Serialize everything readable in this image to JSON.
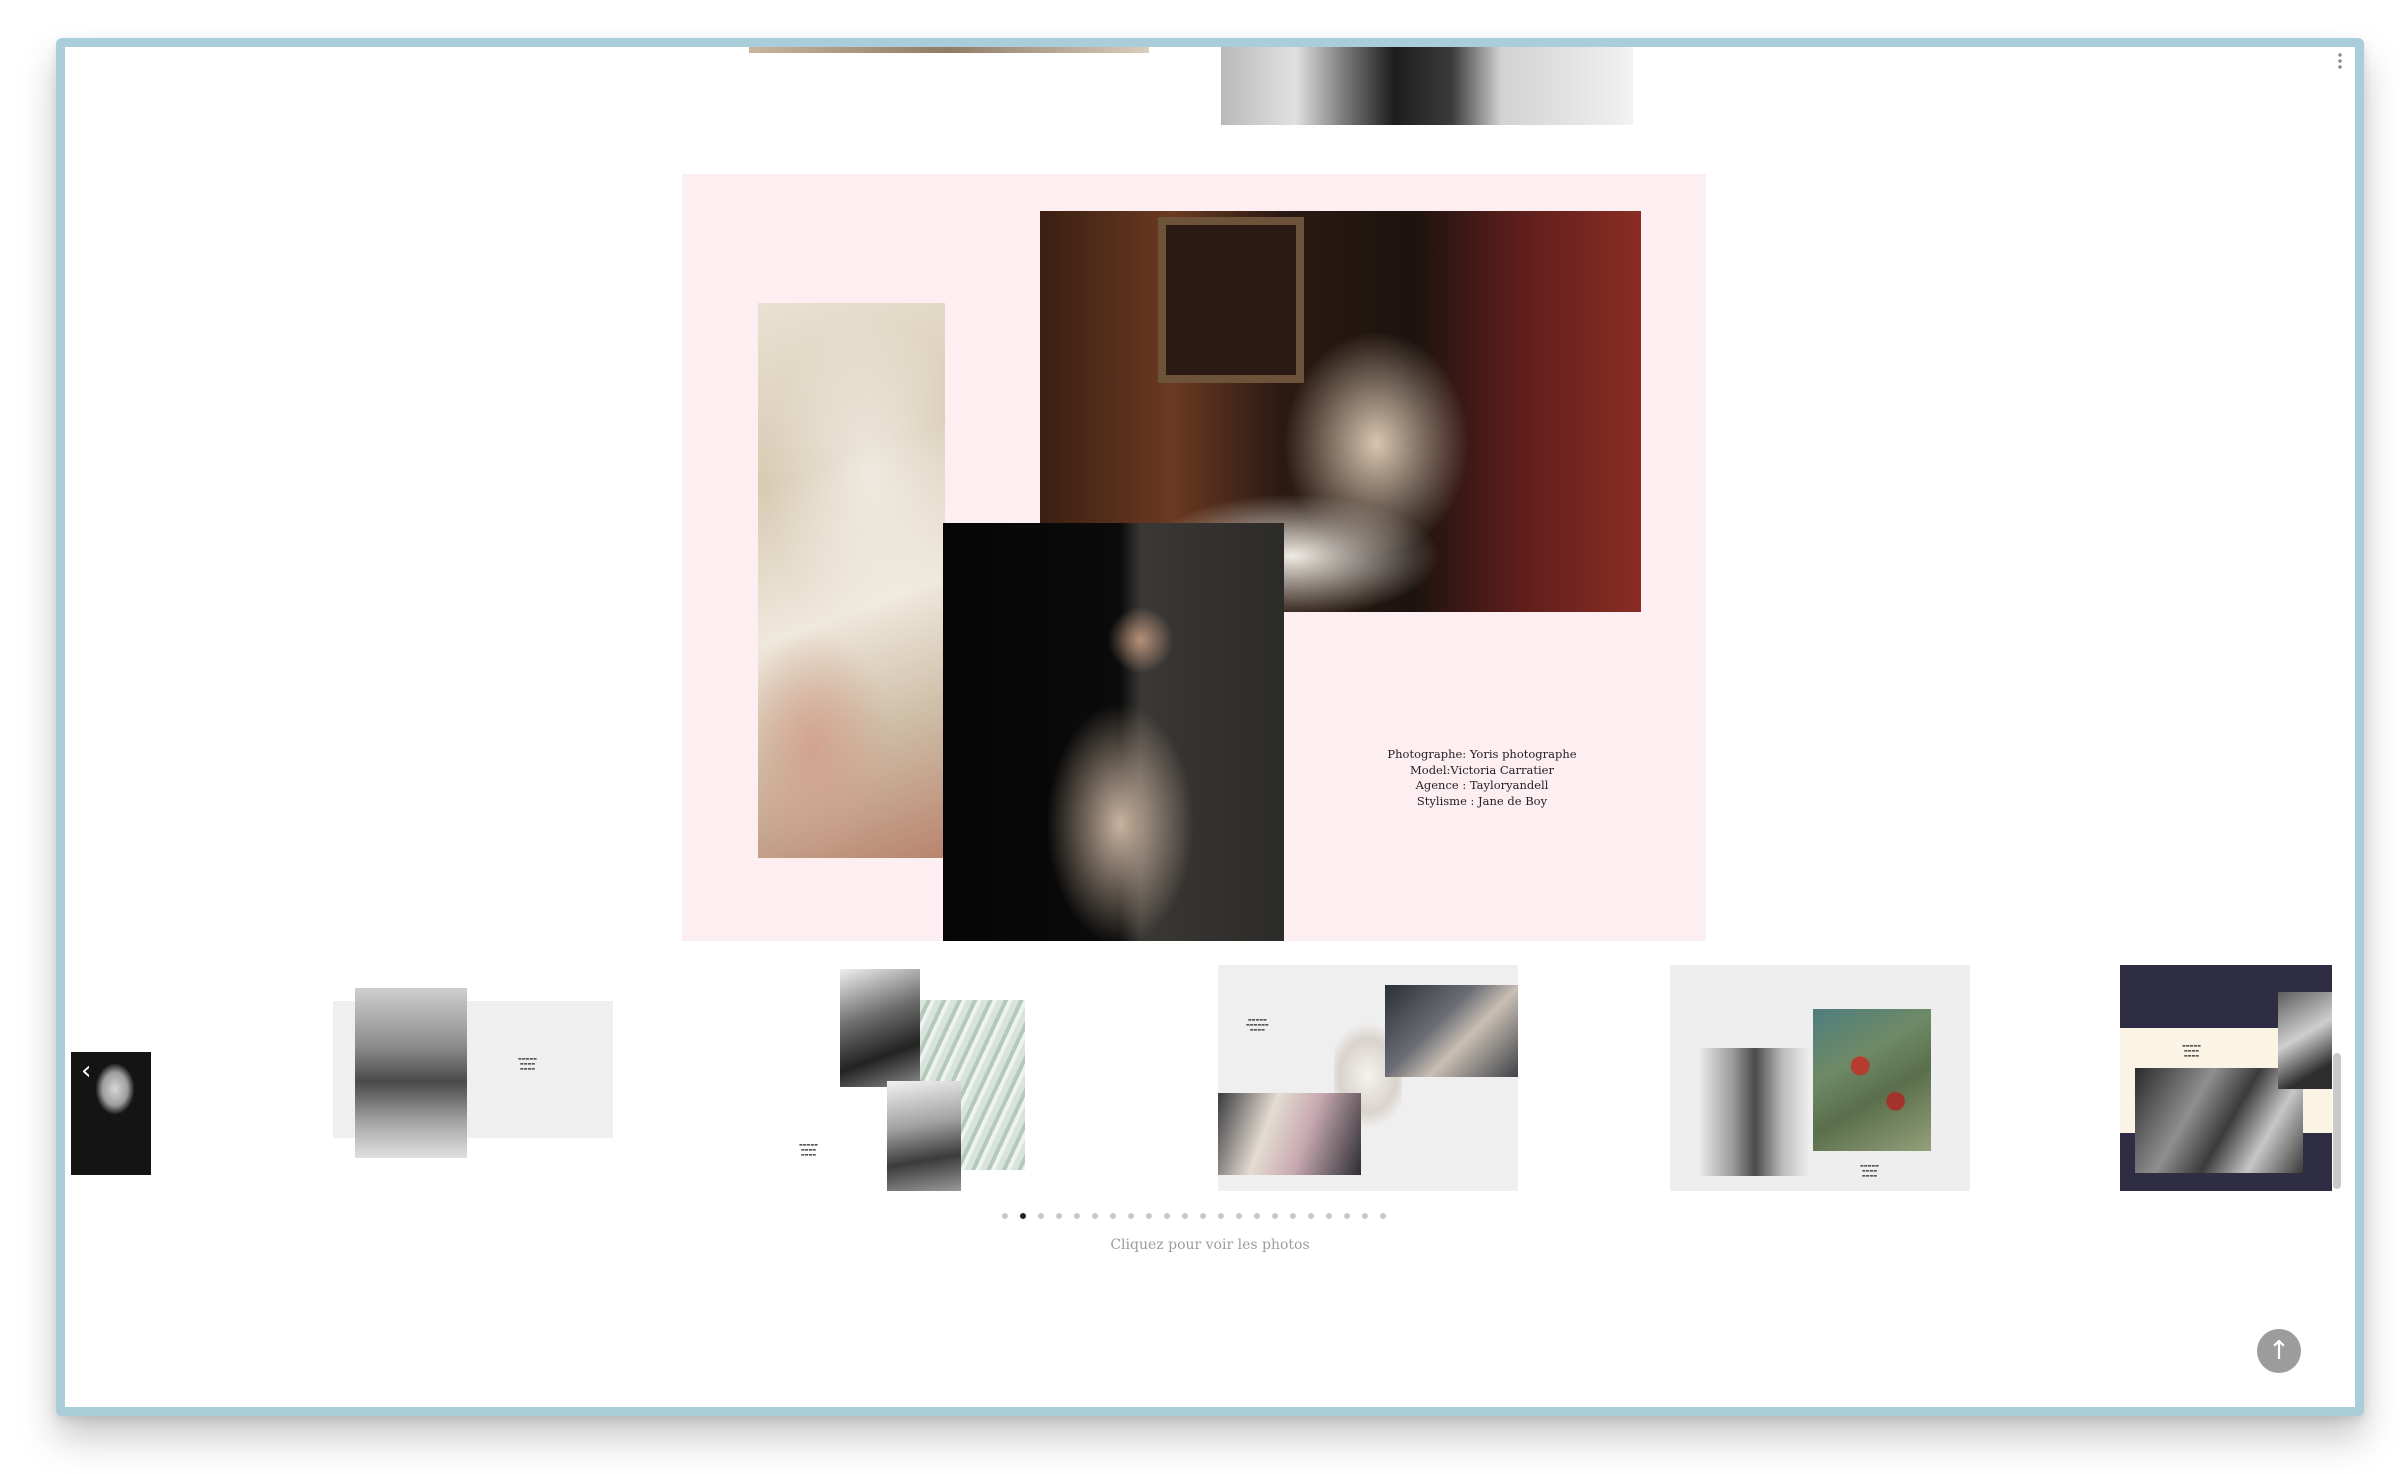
{
  "credits": {
    "photographer": "Photographe: Yoris photographe",
    "model": "Model:Victoria Carratier",
    "agency": "Agence : Tayloryandell",
    "stylist": "Stylisme : Jane de Boy"
  },
  "gallery": {
    "hint": "Cliquez pour voir les photos",
    "active_page": 2,
    "total_pages": 22
  },
  "icons": {
    "prev": "chevron-left-icon",
    "scroll_top": "arrow-up-icon"
  },
  "colors": {
    "spread_background": "#fdeef1",
    "frame_border": "#a9cdd9",
    "thumb_dark_background": "#2f2d44"
  }
}
